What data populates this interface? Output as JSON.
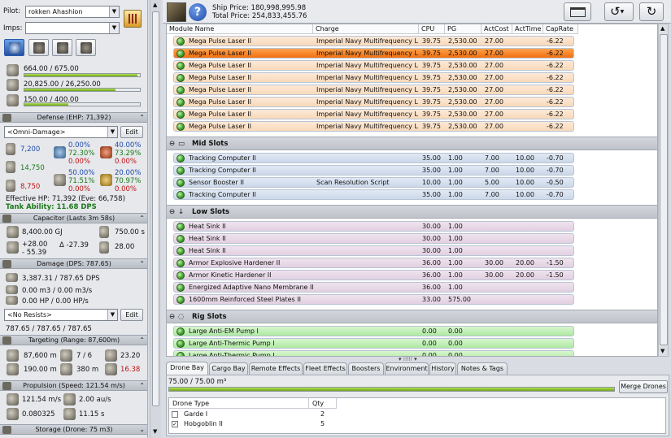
{
  "pilot": {
    "label": "Pilot:",
    "value": "rokken Ahashion",
    "imps_label": "Imps:",
    "imps_value": ""
  },
  "resources": {
    "cpu": "664.00 / 675.00",
    "cpu_level": 0.98,
    "pg": "20,825.00 / 26,250.00",
    "pg_level": 0.79,
    "calib": "150.00 / 400.00",
    "calib_level": 0.38
  },
  "defense": {
    "header": "Defense (EHP: 71,392)",
    "profile": "<Omni-Damage>",
    "edit": "Edit",
    "shield": "7,200",
    "armor": "14,750",
    "hull": "8,750",
    "em": [
      "0.00%",
      "72.30%",
      "0.00%"
    ],
    "th": [
      "40.00%",
      "73.29%",
      "0.00%"
    ],
    "ki": [
      "50.00%",
      "71.51%",
      "0.00%"
    ],
    "ex": [
      "20.00%",
      "70.97%",
      "0.00%"
    ],
    "ehp": "Effective HP: 71,392 (Eve: 66,758)",
    "tank": "Tank Ability: 11.68 DPS"
  },
  "capacitor": {
    "header": "Capacitor (Lasts 3m 58s)",
    "amount": "8,400.00 GJ",
    "recharge": "750.00 s",
    "plus": "+28.00",
    "minus": "- 55.39",
    "delta": "Δ -27.39",
    "booster": "28.00"
  },
  "damage": {
    "header": "Damage (DPS: 787.65)",
    "turret": "3,387.31 / 787.65 DPS",
    "missile": "0.00 m3 / 0.00 m3/s",
    "smart": "0.00 HP / 0.00 HP/s",
    "profile": "<No Resists>",
    "edit": "Edit",
    "total": "787.65 / 787.65 / 787.65"
  },
  "targeting": {
    "header": "Targeting (Range: 87,600m)",
    "range": "87,600 m",
    "targets": "7 / 6",
    "res": "23.20",
    "sig": "190.00 m",
    "scan": "380 m",
    "str": "16.38"
  },
  "propulsion": {
    "header": "Propulsion (Speed: 121.54 m/s)",
    "speed": "121.54 m/s",
    "warp": "2.00 au/s",
    "agility": "0.080325",
    "align": "11.15 s"
  },
  "storage": {
    "header": "Storage (Drone: 75 m3)"
  },
  "ship": {
    "price": "Ship Price: 180,998,995.98",
    "total": "Total Price: 254,833,455.76"
  },
  "table": {
    "columns": [
      "Module Name",
      "Charge",
      "CPU",
      "PG",
      "ActCost",
      "ActTime",
      "CapRate"
    ],
    "high": [
      [
        "Mega Pulse Laser II",
        "Imperial Navy Multifrequency L",
        "39.75",
        "2,530.00",
        "27.00",
        "",
        "-6.22"
      ],
      [
        "Mega Pulse Laser II",
        "Imperial Navy Multifrequency L",
        "39.75",
        "2,530.00",
        "27.00",
        "",
        "-6.22"
      ],
      [
        "Mega Pulse Laser II",
        "Imperial Navy Multifrequency L",
        "39.75",
        "2,530.00",
        "27.00",
        "",
        "-6.22"
      ],
      [
        "Mega Pulse Laser II",
        "Imperial Navy Multifrequency L",
        "39.75",
        "2,530.00",
        "27.00",
        "",
        "-6.22"
      ],
      [
        "Mega Pulse Laser II",
        "Imperial Navy Multifrequency L",
        "39.75",
        "2,530.00",
        "27.00",
        "",
        "-6.22"
      ],
      [
        "Mega Pulse Laser II",
        "Imperial Navy Multifrequency L",
        "39.75",
        "2,530.00",
        "27.00",
        "",
        "-6.22"
      ],
      [
        "Mega Pulse Laser II",
        "Imperial Navy Multifrequency L",
        "39.75",
        "2,530.00",
        "27.00",
        "",
        "-6.22"
      ],
      [
        "Mega Pulse Laser II",
        "Imperial Navy Multifrequency L",
        "39.75",
        "2,530.00",
        "27.00",
        "",
        "-6.22"
      ]
    ],
    "mid_title": "Mid Slots",
    "mid": [
      [
        "Tracking Computer II",
        "",
        "35.00",
        "1.00",
        "7.00",
        "10.00",
        "-0.70"
      ],
      [
        "Tracking Computer II",
        "",
        "35.00",
        "1.00",
        "7.00",
        "10.00",
        "-0.70"
      ],
      [
        "Sensor Booster II",
        "Scan Resolution Script",
        "10.00",
        "1.00",
        "5.00",
        "10.00",
        "-0.50"
      ],
      [
        "Tracking Computer II",
        "",
        "35.00",
        "1.00",
        "7.00",
        "10.00",
        "-0.70"
      ]
    ],
    "low_title": "Low Slots",
    "low": [
      [
        "Heat Sink II",
        "",
        "30.00",
        "1.00",
        "",
        "",
        ""
      ],
      [
        "Heat Sink II",
        "",
        "30.00",
        "1.00",
        "",
        "",
        ""
      ],
      [
        "Heat Sink II",
        "",
        "30.00",
        "1.00",
        "",
        "",
        ""
      ],
      [
        "Armor Explosive Hardener II",
        "",
        "36.00",
        "1.00",
        "30.00",
        "20.00",
        "-1.50"
      ],
      [
        "Armor Kinetic Hardener II",
        "",
        "36.00",
        "1.00",
        "30.00",
        "20.00",
        "-1.50"
      ],
      [
        "Energized Adaptive Nano Membrane II",
        "",
        "36.00",
        "1.00",
        "",
        "",
        ""
      ],
      [
        "1600mm Reinforced Steel Plates II",
        "",
        "33.00",
        "575.00",
        "",
        "",
        ""
      ]
    ],
    "rig_title": "Rig Slots",
    "rig": [
      [
        "Large Anti-EM Pump I",
        "",
        "0.00",
        "0.00",
        "",
        "",
        ""
      ],
      [
        "Large Anti-Thermic Pump I",
        "",
        "0.00",
        "0.00",
        "",
        "",
        ""
      ],
      [
        "Large Anti-Thermic Pump I",
        "",
        "0.00",
        "0.00",
        "",
        "",
        ""
      ]
    ]
  },
  "tabs": [
    "Drone Bay",
    "Cargo Bay",
    "Remote Effects",
    "Fleet Effects",
    "Boosters",
    "Environment",
    "History",
    "Notes & Tags"
  ],
  "drone_bay": {
    "capacity": "75.00 / 75.00 m³",
    "capacity_level": 1.0,
    "merge": "Merge Drones",
    "col_type": "Drone Type",
    "col_qty": "Qty",
    "rows": [
      {
        "name": "Garde I",
        "qty": "2",
        "checked": false
      },
      {
        "name": "Hobgoblin II",
        "qty": "5",
        "checked": true
      }
    ]
  }
}
